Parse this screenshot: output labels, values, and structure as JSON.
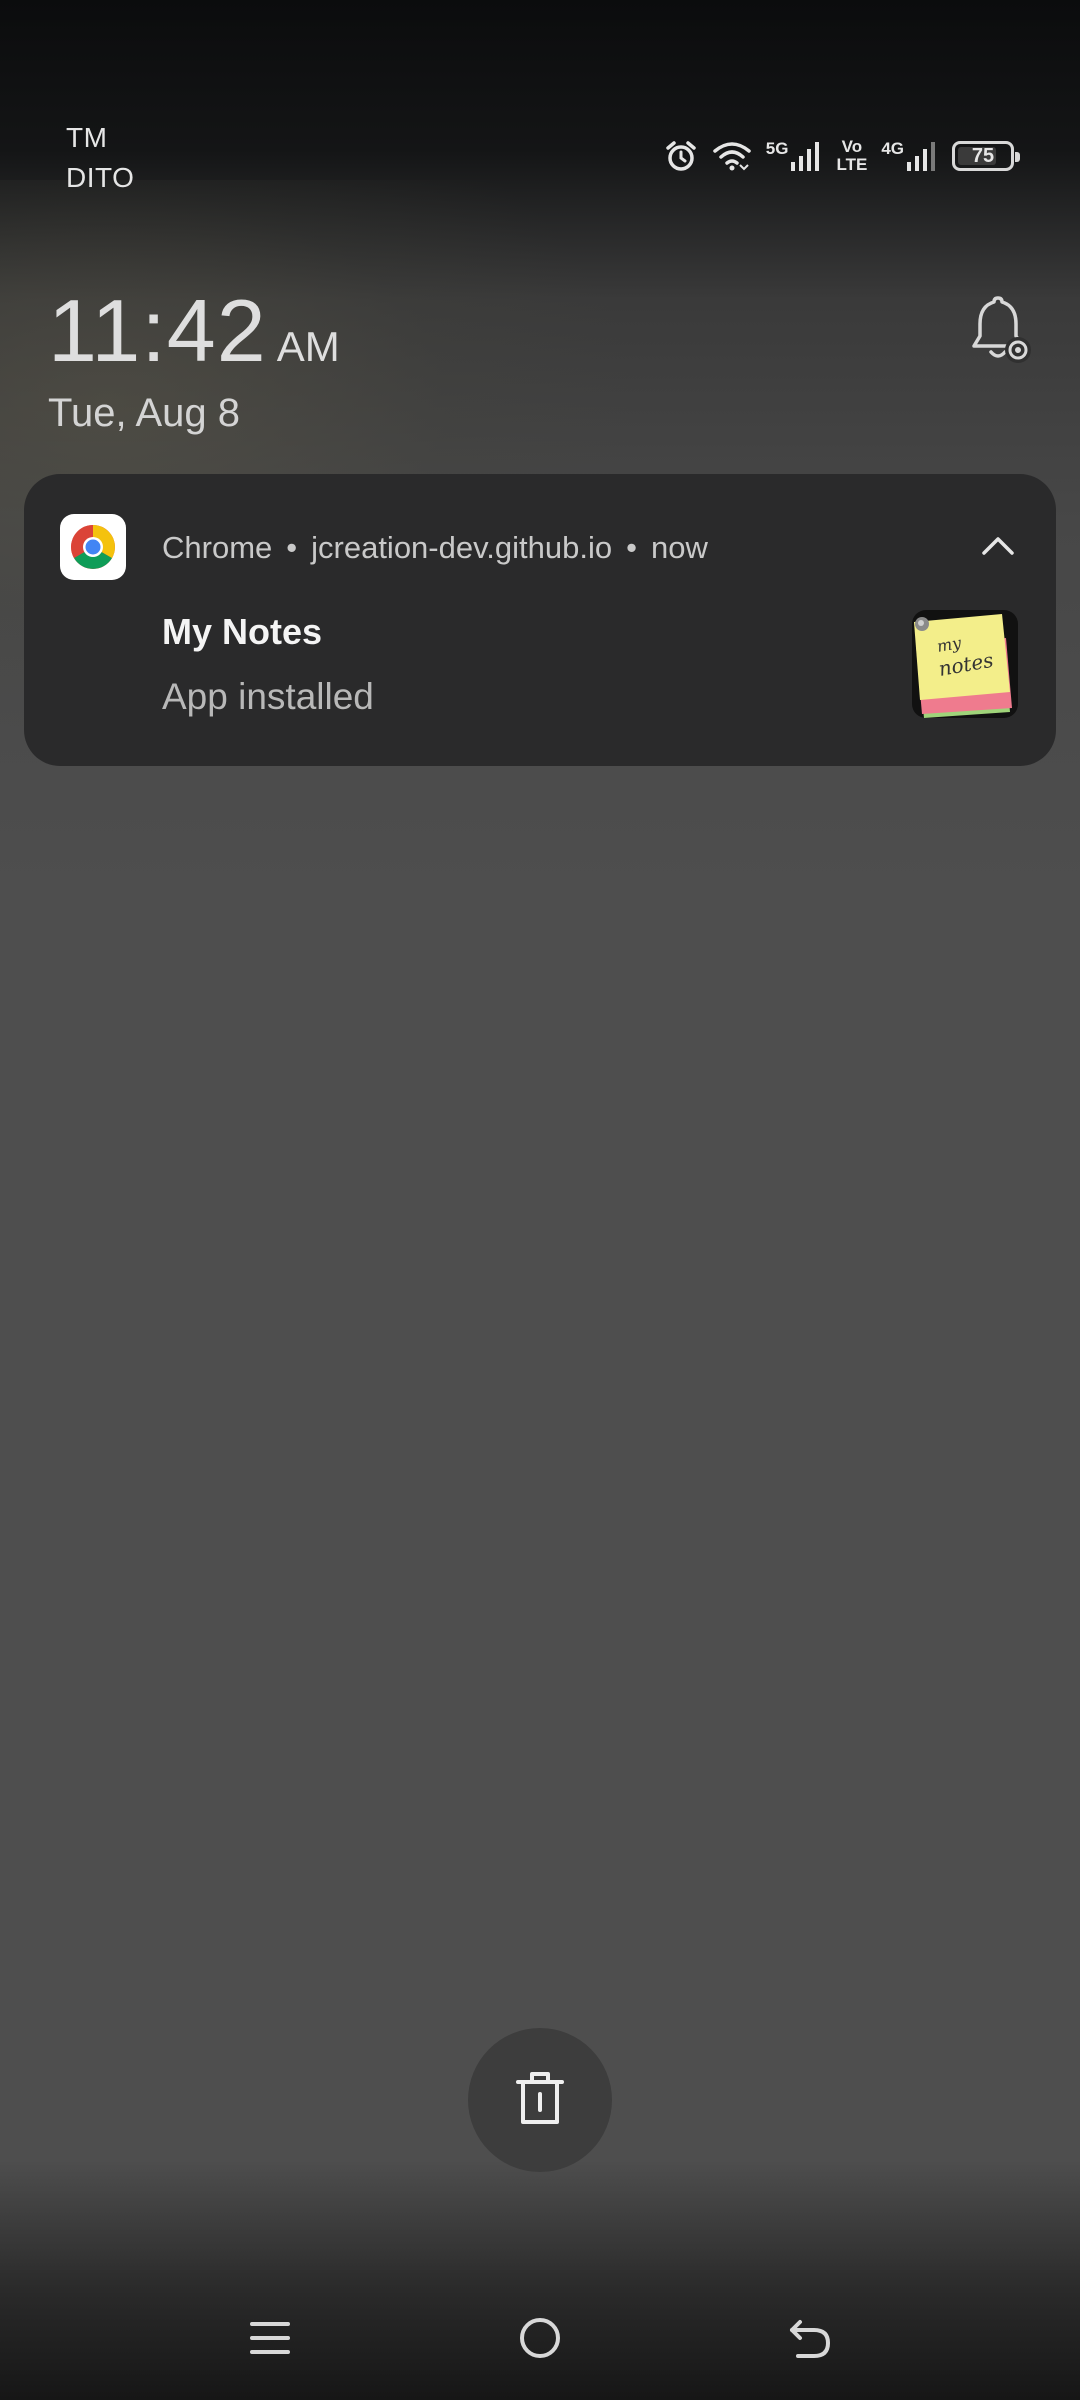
{
  "status_bar": {
    "carrier_line1": "TM",
    "carrier_line2": "DITO",
    "net1_label": "5G",
    "volte_top": "Vo",
    "volte_bottom": "LTE",
    "net2_label": "4G",
    "battery_level": "75",
    "battery_fraction": 0.75,
    "icons": [
      "alarm-icon",
      "wifi-icon",
      "signal-icon",
      "signal-icon",
      "battery-icon"
    ]
  },
  "lockscreen": {
    "time": "11:42",
    "ampm": "AM",
    "date": "Tue, Aug 8"
  },
  "notification": {
    "app_name": "Chrome",
    "source": "jcreation-dev.github.io",
    "time": "now",
    "title": "My Notes",
    "body": "App installed",
    "large_icon_text": "my notes"
  },
  "colors": {
    "card_bg": "#2a2a2b",
    "chrome_red": "#db4437",
    "chrome_yellow": "#f4c20d",
    "chrome_green": "#0f9d58",
    "chrome_blue": "#4285f4",
    "note_yellow": "#f3ee8a",
    "note_pink": "#ef7b8e",
    "note_green": "#9fd47a"
  },
  "actions": {
    "clear_icon": "trash-icon"
  },
  "nav": {
    "items": [
      "menu-icon",
      "home-icon",
      "back-icon"
    ]
  }
}
